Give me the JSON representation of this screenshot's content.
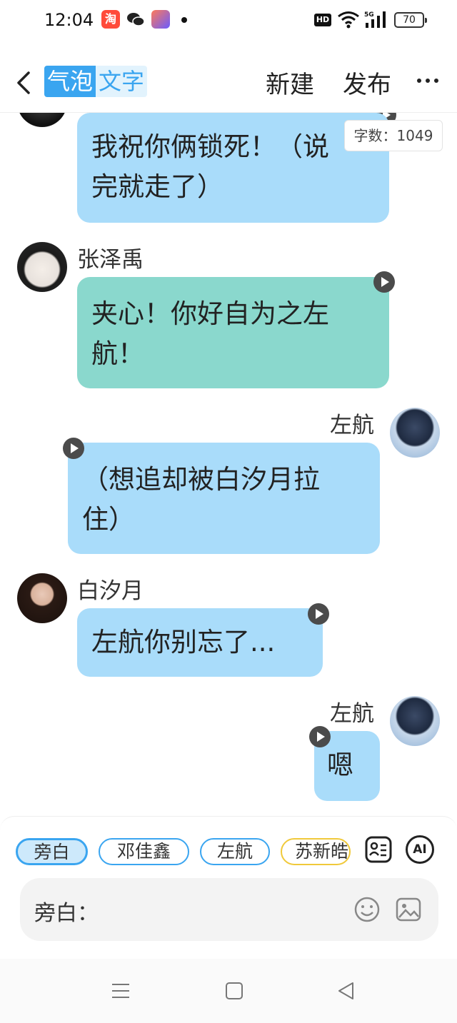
{
  "status": {
    "time": "12:04",
    "hd": "HD",
    "network": "5G",
    "battery": "70",
    "taobao_glyph": "淘"
  },
  "header": {
    "title_part1": "气泡",
    "title_part2": "文字",
    "new_label": "新建",
    "publish_label": "发布"
  },
  "word_count": "字数：1049",
  "messages": [
    {
      "id": "m0",
      "side": "left",
      "text_line1": "我祝你俩锁死！（说",
      "text_line2": "完就走了）"
    },
    {
      "id": "m1",
      "side": "left",
      "name": "张泽禹",
      "text_line1": "夹心！你好自为之左",
      "text_line2": "航！"
    },
    {
      "id": "m2",
      "side": "right",
      "name": "左航",
      "text_line1": "（想追却被白汐月拉",
      "text_line2": "住）"
    },
    {
      "id": "m3",
      "side": "left",
      "name": "白汐月",
      "text_line1": "左航你别忘了..."
    },
    {
      "id": "m4",
      "side": "right",
      "name": "左航",
      "text_line1": "嗯"
    }
  ],
  "characters": [
    "旁白",
    "邓佳鑫",
    "左航",
    "苏新皓"
  ],
  "tools": {
    "ai_label": "AI"
  },
  "input": {
    "label": "旁白："
  },
  "colors": {
    "accent": "#3aa5f0",
    "bubble_blue": "#a9dcfa",
    "bubble_green": "#8ad8cd",
    "chip_yellow": "#f0c93a"
  },
  "icons": [
    "back-arrow-icon",
    "more-icon",
    "play-icon",
    "contact-card-icon",
    "ai-icon",
    "emoji-icon",
    "image-icon",
    "menu-icon",
    "home-icon",
    "back-nav-icon"
  ]
}
